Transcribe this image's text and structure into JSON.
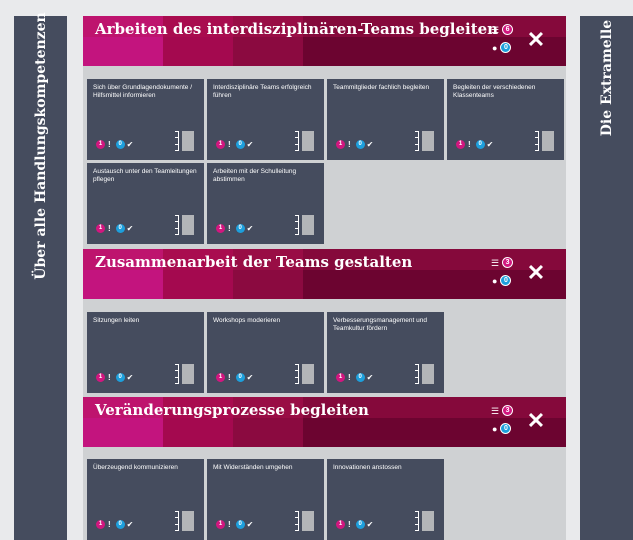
{
  "sidebar_left": {
    "label": "Über alle Handlungskompetenzen"
  },
  "sidebar_right": {
    "label": "Die Extramelle"
  },
  "icons": {
    "list": "list-icon",
    "user": "user-icon",
    "close": "close-icon",
    "alert": "exclamation-icon",
    "check": "check-icon"
  },
  "colors": {
    "magenta": "#c3147e",
    "dark_red": "#6c0430",
    "tile": "#454c5e",
    "blue": "#1d9fdc",
    "pink_badge": "#d2177f"
  },
  "sections": [
    {
      "title": "Arbeiten des interdisziplinären-Teams begleiten",
      "list_count": "6",
      "user_count": "0",
      "tiles": [
        {
          "label": "Sich über Grundlagendokumente / Hilfsmittel informieren",
          "pink": "1",
          "blue": "0"
        },
        {
          "label": "Interdisziplinäre Teams erfolgreich führen",
          "pink": "1",
          "blue": "0"
        },
        {
          "label": "Teammitglieder fachlich begleiten",
          "pink": "1",
          "blue": "0"
        },
        {
          "label": "Begleiten der verschiedenen Klassenteams",
          "pink": "1",
          "blue": "0"
        },
        {
          "label": "Austausch unter den Teamleitungen pflegen",
          "pink": "1",
          "blue": "0"
        },
        {
          "label": "Arbeiten mit der Schulleitung abstimmen",
          "pink": "1",
          "blue": "0"
        }
      ]
    },
    {
      "title": "Zusammenarbeit der Teams gestalten",
      "list_count": "3",
      "user_count": "0",
      "tiles": [
        {
          "label": "Sitzungen leiten",
          "pink": "1",
          "blue": "0"
        },
        {
          "label": "Workshops moderieren",
          "pink": "1",
          "blue": "0"
        },
        {
          "label": "Verbesserungsmanagement und Teamkultur fördern",
          "pink": "1",
          "blue": "0"
        }
      ]
    },
    {
      "title": "Veränderungsprozesse begleiten",
      "list_count": "3",
      "user_count": "0",
      "tiles": [
        {
          "label": "Überzeugend kommunizieren",
          "pink": "1",
          "blue": "0"
        },
        {
          "label": "Mit Widerständen umgehen",
          "pink": "1",
          "blue": "0"
        },
        {
          "label": "Innovationen anstossen",
          "pink": "1",
          "blue": "0"
        }
      ]
    }
  ]
}
